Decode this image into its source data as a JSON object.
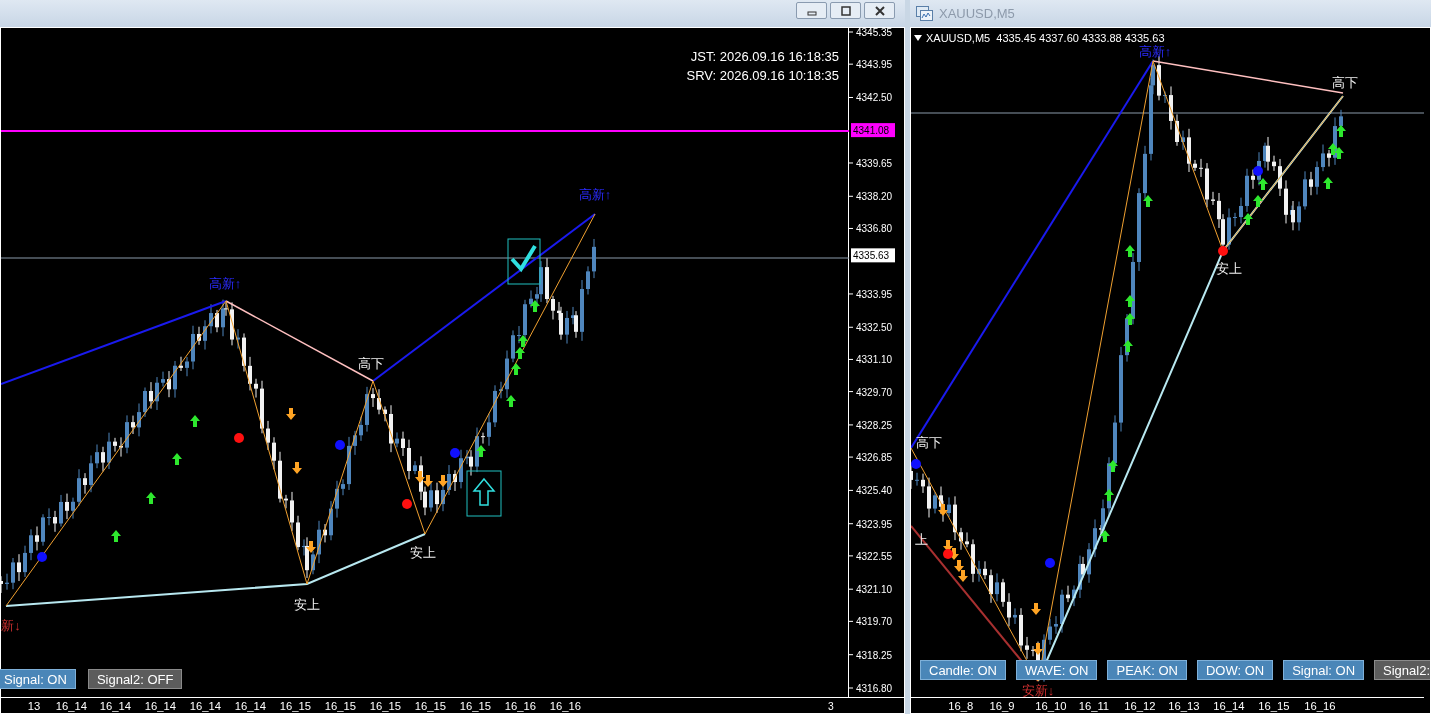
{
  "left_chart": {
    "clock": [
      "JST: 2026.09.16 16:18:35",
      "SRV: 2026.09.16 10:18:35"
    ],
    "price_axis": [
      "4345.35",
      "4343.95",
      "4342.50",
      "4339.65",
      "4338.20",
      "4336.80",
      "4333.95",
      "4332.50",
      "4331.10",
      "4329.70",
      "4328.25",
      "4326.85",
      "4325.40",
      "4323.95",
      "4322.55",
      "4321.10",
      "4319.70",
      "4318.25",
      "4316.80"
    ],
    "price_tags": [
      {
        "text": "4341.08",
        "kind": "line"
      },
      {
        "text": "4335.63",
        "kind": "bid"
      }
    ],
    "axis_corner": "3",
    "time_axis": [
      "13",
      "16_14",
      "16_14",
      "16_14",
      "16_14",
      "16_14",
      "16_15",
      "16_15",
      "16_15",
      "16_15",
      "16_15",
      "16_16",
      "16_16"
    ],
    "labels": [
      {
        "text": "高新↑",
        "kind": "high_new"
      },
      {
        "text": "高新↑",
        "kind": "high_new"
      },
      {
        "text": "高下",
        "kind": "high_low"
      },
      {
        "text": "安上",
        "kind": "low_up"
      },
      {
        "text": "安上",
        "kind": "low_up"
      },
      {
        "text": "新↓",
        "kind": "low_new"
      }
    ],
    "buttons": [
      {
        "label": "Signal: ON",
        "on": true
      },
      {
        "label": "Signal2: OFF",
        "on": false
      }
    ]
  },
  "right_window": {
    "title": "XAUUSD,M5",
    "info": "XAUUSD,M5  4335.45 4337.60 4333.88 4335.63",
    "time_axis": [
      "16_8",
      "16_9",
      "16_10",
      "16_11",
      "16_12",
      "16_13",
      "16_14",
      "16_15",
      "16_16"
    ],
    "labels": [
      {
        "text": "高新↑",
        "kind": "high_new"
      },
      {
        "text": "高下",
        "kind": "high_low"
      },
      {
        "text": "高下",
        "kind": "high_low"
      },
      {
        "text": "安上",
        "kind": "low_up"
      },
      {
        "text": "上",
        "kind": "low_up"
      },
      {
        "text": "安新↓",
        "kind": "low_new"
      }
    ],
    "buttons": [
      {
        "label": "Candle: ON",
        "on": true
      },
      {
        "label": "WAVE: ON",
        "on": true
      },
      {
        "label": "PEAK: ON",
        "on": true
      },
      {
        "label": "DOW: ON",
        "on": true
      },
      {
        "label": "Signal: ON",
        "on": true
      },
      {
        "label": "Signal2:",
        "on": false
      }
    ]
  }
}
